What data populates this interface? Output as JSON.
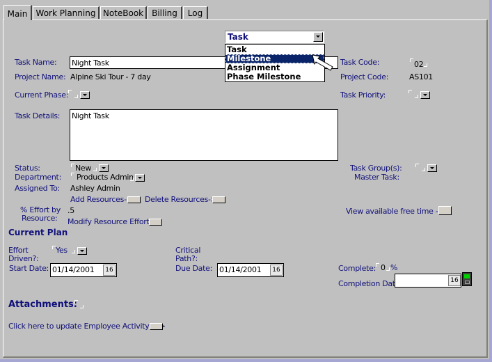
{
  "tabs": [
    {
      "label": "Main",
      "active": true
    },
    {
      "label": "Work Planning",
      "active": false
    },
    {
      "label": "NoteBook",
      "active": false
    },
    {
      "label": "Billing",
      "active": false
    },
    {
      "label": "Log",
      "active": false
    }
  ],
  "type_combo": {
    "selected": "Task",
    "options": [
      "Task",
      "Milestone",
      "Assignment",
      "Phase Milestone"
    ],
    "highlighted": "Milestone"
  },
  "fields": {
    "task_name_label": "Task Name:",
    "task_name_value": "Night Task",
    "project_name_label": "Project Name:",
    "project_name_value": "Alpine Ski Tour - 7 day",
    "current_phase_label": "Current Phase:",
    "current_phase_value": "",
    "task_code_label": "Task Code:",
    "task_code_value": "02",
    "project_code_label": "Project Code:",
    "project_code_value": "AS101",
    "task_priority_label": "Task Priority:",
    "task_priority_value": "",
    "task_details_label": "Task Details:",
    "task_details_value": "Night Task",
    "status_label": "Status:",
    "status_value": "New",
    "department_label": "Department:",
    "department_value": "Products Admin",
    "assigned_to_label": "Assigned To:",
    "assigned_to_value": "Ashley Admin",
    "add_resources_label": "Add Resources->",
    "delete_resources_label": "Delete Resources->",
    "effort_label_1": "% Effort by",
    "effort_label_2": "Resource:",
    "effort_value": ".5",
    "modify_effort_label": "Modify Resource Effort->",
    "task_groups_label": "Task Group(s):",
    "master_task_label": "Master Task:",
    "free_time_label": "View available free time -- >"
  },
  "current_plan": {
    "heading": "Current Plan",
    "effort_driven_label_1": "Effort",
    "effort_driven_label_2": "Driven?:",
    "effort_driven_value": "Yes",
    "critical_path_label_1": "Critical",
    "critical_path_label_2": "Path?:",
    "start_date_label": "Start Date:",
    "start_date_value": "01/14/2001",
    "due_date_label": "Due Date:",
    "due_date_value": "01/14/2001",
    "complete_label": "Complete:",
    "complete_value": "0",
    "complete_unit": "%",
    "completion_date_label": "Completion Date",
    "completion_date_value": "",
    "calendar_glyph": "16"
  },
  "attachments": {
    "heading": "Attachments:",
    "employee_activity_label": "Click here to update Employee Activity --->"
  }
}
